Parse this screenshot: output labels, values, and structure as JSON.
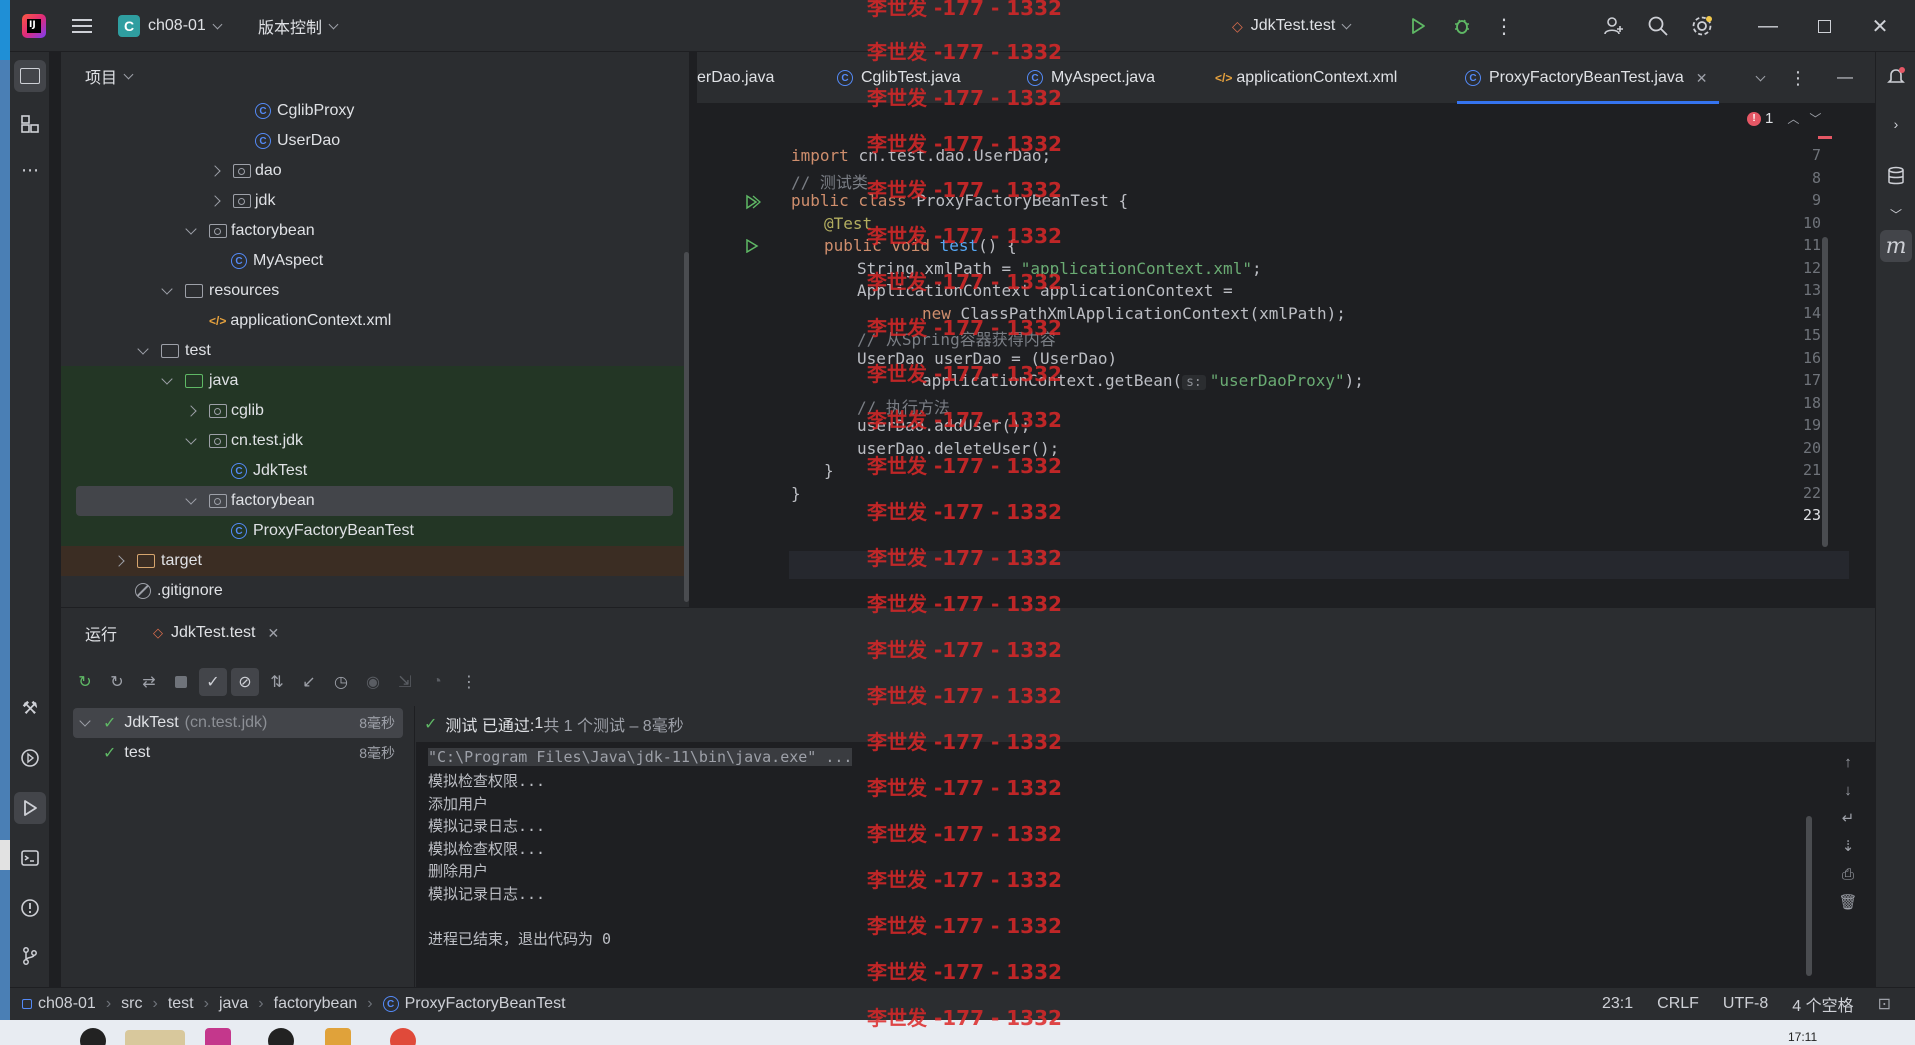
{
  "titlebar": {
    "project_badge": "C",
    "project_name": "ch08-01",
    "vcs_label": "版本控制",
    "run_config": "JdkTest.test"
  },
  "project_panel": {
    "title": "项目",
    "rows": [
      {
        "label": "CglibProxy",
        "kind": "class"
      },
      {
        "label": "UserDao",
        "kind": "class"
      },
      {
        "label": "dao",
        "kind": "package"
      },
      {
        "label": "jdk",
        "kind": "package"
      },
      {
        "label": "factorybean",
        "kind": "package"
      },
      {
        "label": "MyAspect",
        "kind": "class"
      },
      {
        "label": "resources",
        "kind": "folder"
      },
      {
        "label": "applicationContext.xml",
        "kind": "xml"
      },
      {
        "label": "test",
        "kind": "folder"
      },
      {
        "label": "java",
        "kind": "folder"
      },
      {
        "label": "cglib",
        "kind": "package"
      },
      {
        "label": "cn.test.jdk",
        "kind": "package"
      },
      {
        "label": "JdkTest",
        "kind": "class"
      },
      {
        "label": "factorybean",
        "kind": "package"
      },
      {
        "label": "ProxyFactoryBeanTest",
        "kind": "class"
      },
      {
        "label": "target",
        "kind": "folder"
      },
      {
        "label": ".gitignore",
        "kind": "ignore"
      }
    ]
  },
  "editor": {
    "tabs": [
      {
        "label": "erDao.java"
      },
      {
        "label": "CglibTest.java"
      },
      {
        "label": "MyAspect.java"
      },
      {
        "label": "applicationContext.xml"
      },
      {
        "label": "ProxyFactoryBeanTest.java"
      }
    ],
    "error_count": "1",
    "line_numbers": [
      "7",
      "8",
      "9",
      "10",
      "11",
      "12",
      "13",
      "14",
      "15",
      "16",
      "17",
      "18",
      "19",
      "20",
      "21",
      "22",
      "23"
    ],
    "code": {
      "l7_kw": "import ",
      "l7_rest": "cn.test.dao.UserDao;",
      "l8": "// 测试类",
      "l9_kw": "public class ",
      "l9_rest": "ProxyFactoryBeanTest {",
      "l10": "@Test",
      "l11_kw": "public void ",
      "l11_fn": "test",
      "l11_rest": "() {",
      "l12_a": "String xmlPath = ",
      "l12_str": "\"applicationContext.xml\"",
      "l12_b": ";",
      "l13": "ApplicationContext applicationContext =",
      "l14_kw": "new ",
      "l14_rest": "ClassPathXmlApplicationContext(xmlPath);",
      "l15": "// 从Spring容器获得内容",
      "l16": "UserDao userDao = (UserDao)",
      "l17_a": "applicationContext.getBean(",
      "l17_hint": "s:",
      "l17_str": "\"userDaoProxy\"",
      "l17_b": ");",
      "l18": "// 执行方法",
      "l19": "userDao.addUser();",
      "l20": "userDao.deleteUser();",
      "l21": "}",
      "l22": "}"
    }
  },
  "run_panel": {
    "label": "运行",
    "tab": "JdkTest.test",
    "status_check": "测试 已通过: ",
    "status_count": "1",
    "status_rest": "共 1 个测试 – 8毫秒",
    "tree": [
      {
        "name": "JdkTest",
        "pkg": "(cn.test.jdk)",
        "time": "8毫秒"
      },
      {
        "name": "test",
        "pkg": "",
        "time": "8毫秒"
      }
    ],
    "console": [
      "\"C:\\Program Files\\Java\\jdk-11\\bin\\java.exe\" ...",
      "模拟检查权限...",
      "添加用户",
      "模拟记录日志...",
      "模拟检查权限...",
      "删除用户",
      "模拟记录日志...",
      "",
      "进程已结束，退出代码为 0"
    ]
  },
  "statusbar": {
    "breadcrumb": [
      "ch08-01",
      "src",
      "test",
      "java",
      "factorybean",
      "ProxyFactoryBeanTest"
    ],
    "position": "23:1",
    "line_sep": "CRLF",
    "encoding": "UTF-8",
    "indent": "4 个空格"
  },
  "taskbar": {
    "time": "17:11"
  },
  "watermark": "李世发 -177 - 1332"
}
